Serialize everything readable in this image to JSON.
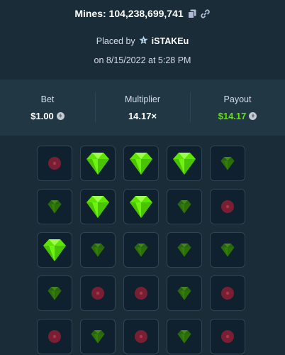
{
  "header": {
    "title": "Mines: 104,238,699,741",
    "placed_by_prefix": "Placed by",
    "username": "iSTAKEu",
    "date": "on 8/15/2022 at 5:28 PM"
  },
  "stats": {
    "bet_label": "Bet",
    "bet_value": "$1.00",
    "multiplier_label": "Multiplier",
    "multiplier_value": "14.17×",
    "payout_label": "Payout",
    "payout_value": "$14.17"
  },
  "colors": {
    "gem_green": "#5ee600",
    "mine_red": "#7a1f33",
    "payout_green": "#5ee600",
    "background": "#1a2c38",
    "panel": "#213743"
  },
  "grid": {
    "rows": [
      [
        "mine",
        "gem-revealed",
        "gem-revealed",
        "gem-revealed",
        "gem"
      ],
      [
        "gem",
        "gem-revealed",
        "gem-revealed",
        "gem",
        "mine"
      ],
      [
        "gem-revealed",
        "gem",
        "gem",
        "gem",
        "gem"
      ],
      [
        "gem",
        "mine",
        "mine",
        "gem",
        "mine"
      ],
      [
        "mine",
        "gem",
        "mine",
        "gem",
        "mine"
      ]
    ]
  }
}
